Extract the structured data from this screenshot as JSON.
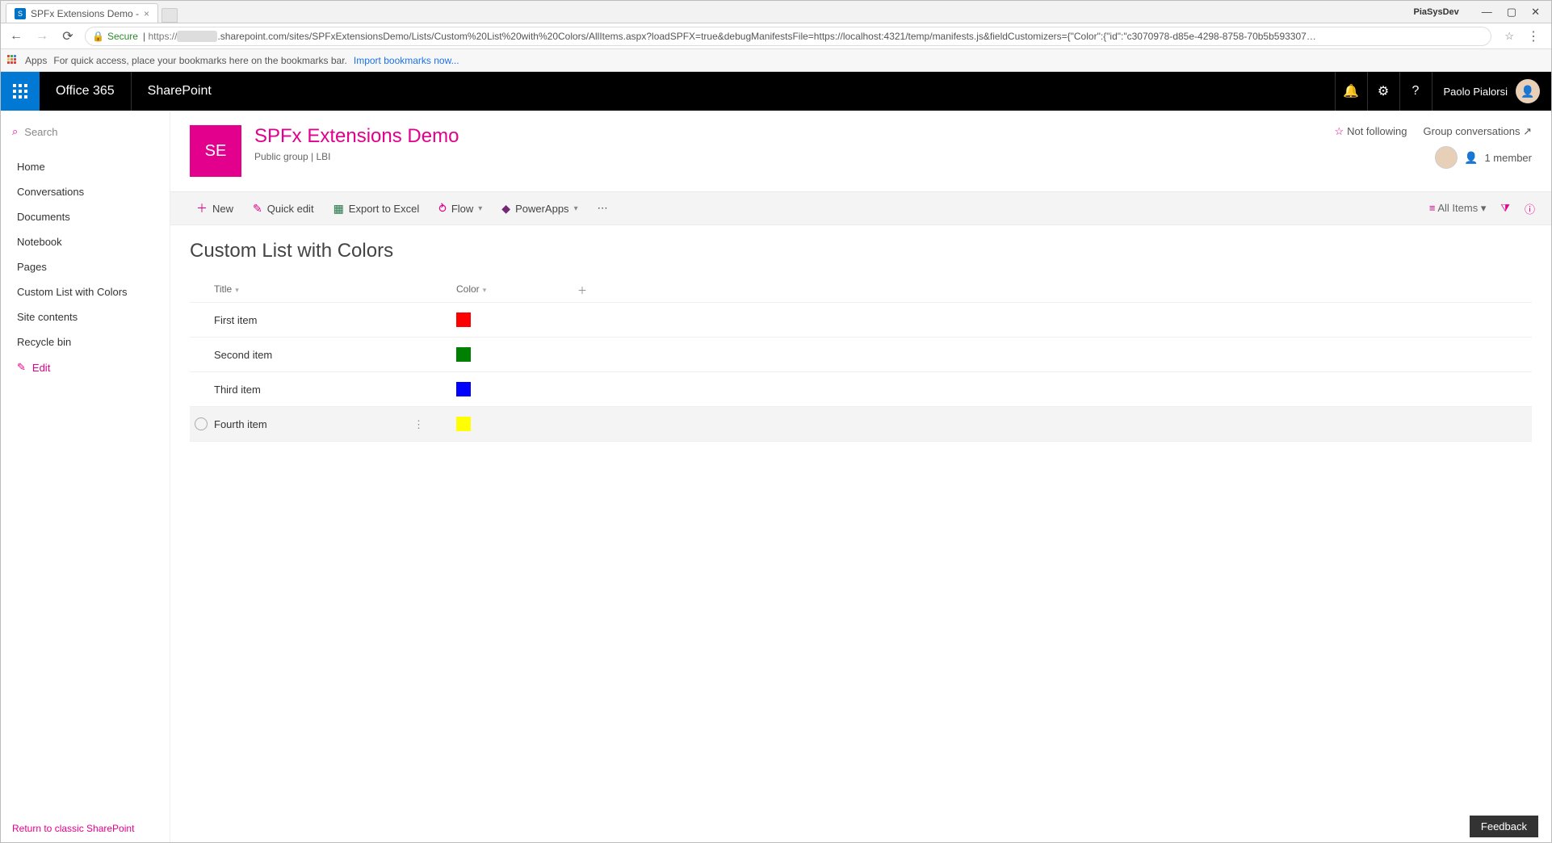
{
  "browser": {
    "tab_title": "SPFx Extensions Demo -",
    "window_label": "PiaSysDev",
    "secure_label": "Secure",
    "url_prefix": "https://",
    "url_rest": ".sharepoint.com/sites/SPFxExtensionsDemo/Lists/Custom%20List%20with%20Colors/AllItems.aspx?loadSPFX=true&debugManifestsFile=https://localhost:4321/temp/manifests.js&fieldCustomizers={\"Color\":{\"id\":\"c3070978-d85e-4298-8758-70b5b593307…",
    "apps_label": "Apps",
    "bookmark_hint": "For quick access, place your bookmarks here on the bookmarks bar.",
    "import_link": "Import bookmarks now..."
  },
  "suite": {
    "brand": "Office 365",
    "app": "SharePoint",
    "user": "Paolo Pialorsi"
  },
  "nav": {
    "search": "Search",
    "items": [
      "Home",
      "Conversations",
      "Documents",
      "Notebook",
      "Pages",
      "Custom List with Colors",
      "Site contents",
      "Recycle bin"
    ],
    "edit": "Edit",
    "return_link": "Return to classic SharePoint",
    "feedback": "Feedback"
  },
  "site": {
    "logo_text": "SE",
    "title": "SPFx Extensions Demo",
    "subtitle": "Public group  |  LBI",
    "not_following": "Not following",
    "group_conv": "Group conversations ↗",
    "members": "1 member"
  },
  "cmd": {
    "new": "New",
    "quick_edit": "Quick edit",
    "export": "Export to Excel",
    "flow": "Flow",
    "powerapps": "PowerApps",
    "view": "All Items"
  },
  "list": {
    "title": "Custom List with Colors",
    "col_title": "Title",
    "col_color": "Color",
    "rows": [
      {
        "title": "First item",
        "color": "#ff0000"
      },
      {
        "title": "Second item",
        "color": "#008000"
      },
      {
        "title": "Third item",
        "color": "#0000ff"
      },
      {
        "title": "Fourth item",
        "color": "#ffff00"
      }
    ]
  }
}
